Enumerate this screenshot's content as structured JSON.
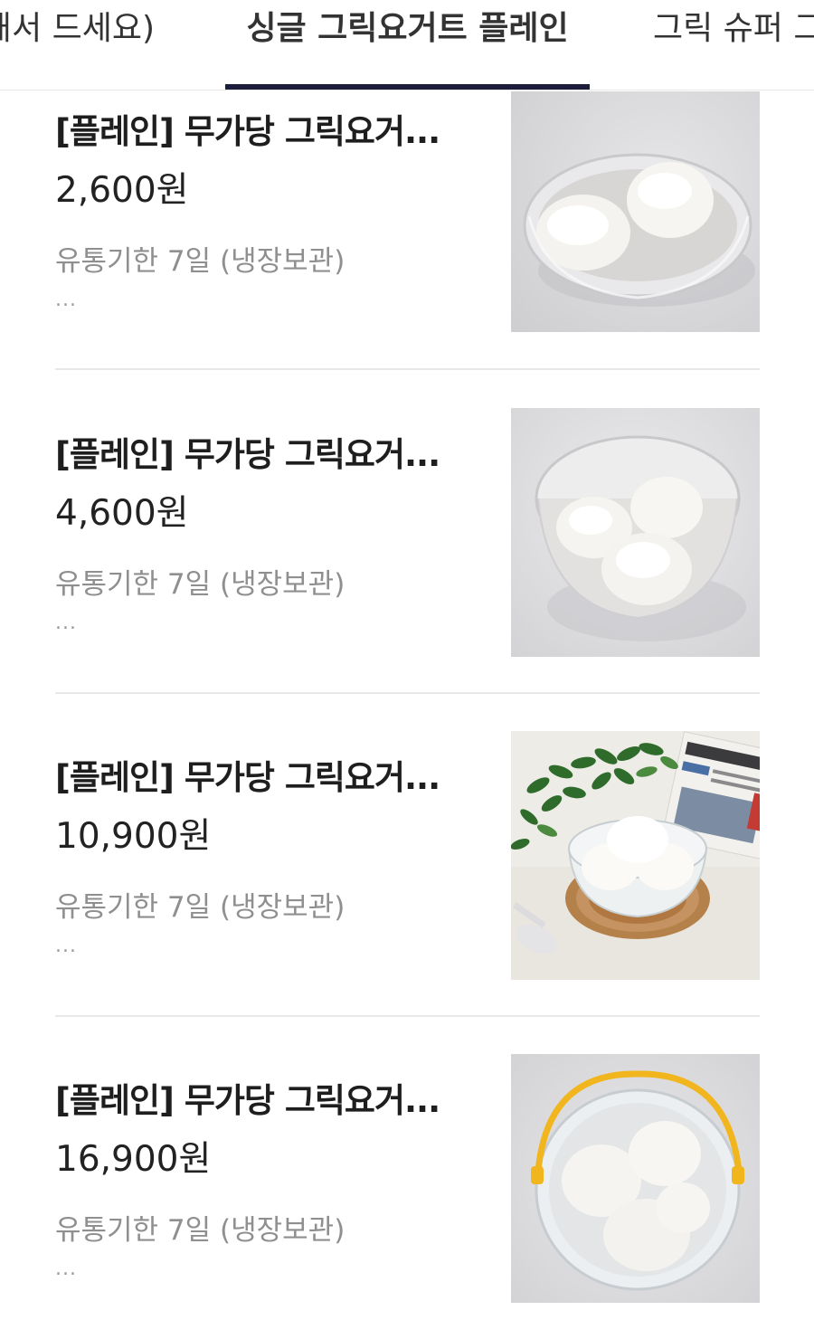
{
  "tabs": [
    {
      "label": "왜서 드세요)",
      "active": false
    },
    {
      "label": "싱글 그릭요거트 플레인",
      "active": true
    },
    {
      "label": "그릭 슈퍼 그",
      "active": false
    }
  ],
  "colors": {
    "accent": "#1c1d3a",
    "meta_text": "#8f8f8f"
  },
  "products": [
    {
      "name": "[플레인] 무가당 그릭요거...",
      "price": "2,600원",
      "shelf_life": "유통기한 7일 (냉장보관)",
      "more": "...",
      "image": "two-scoop-plastic-bowl"
    },
    {
      "name": "[플레인] 무가당 그릭요거...",
      "price": "4,600원",
      "shelf_life": "유통기한 7일 (냉장보관)",
      "more": "...",
      "image": "three-scoop-plastic-bowl"
    },
    {
      "name": "[플레인] 무가당 그릭요거...",
      "price": "10,900원",
      "shelf_life": "유통기한 7일 (냉장보관)",
      "more": "...",
      "image": "glass-bowl-with-leaves-and-newspaper"
    },
    {
      "name": "[플레인] 무가당 그릭요거...",
      "price": "16,900원",
      "shelf_life": "유통기한 7일 (냉장보관)",
      "more": "...",
      "image": "bucket-with-yellow-handle"
    }
  ]
}
